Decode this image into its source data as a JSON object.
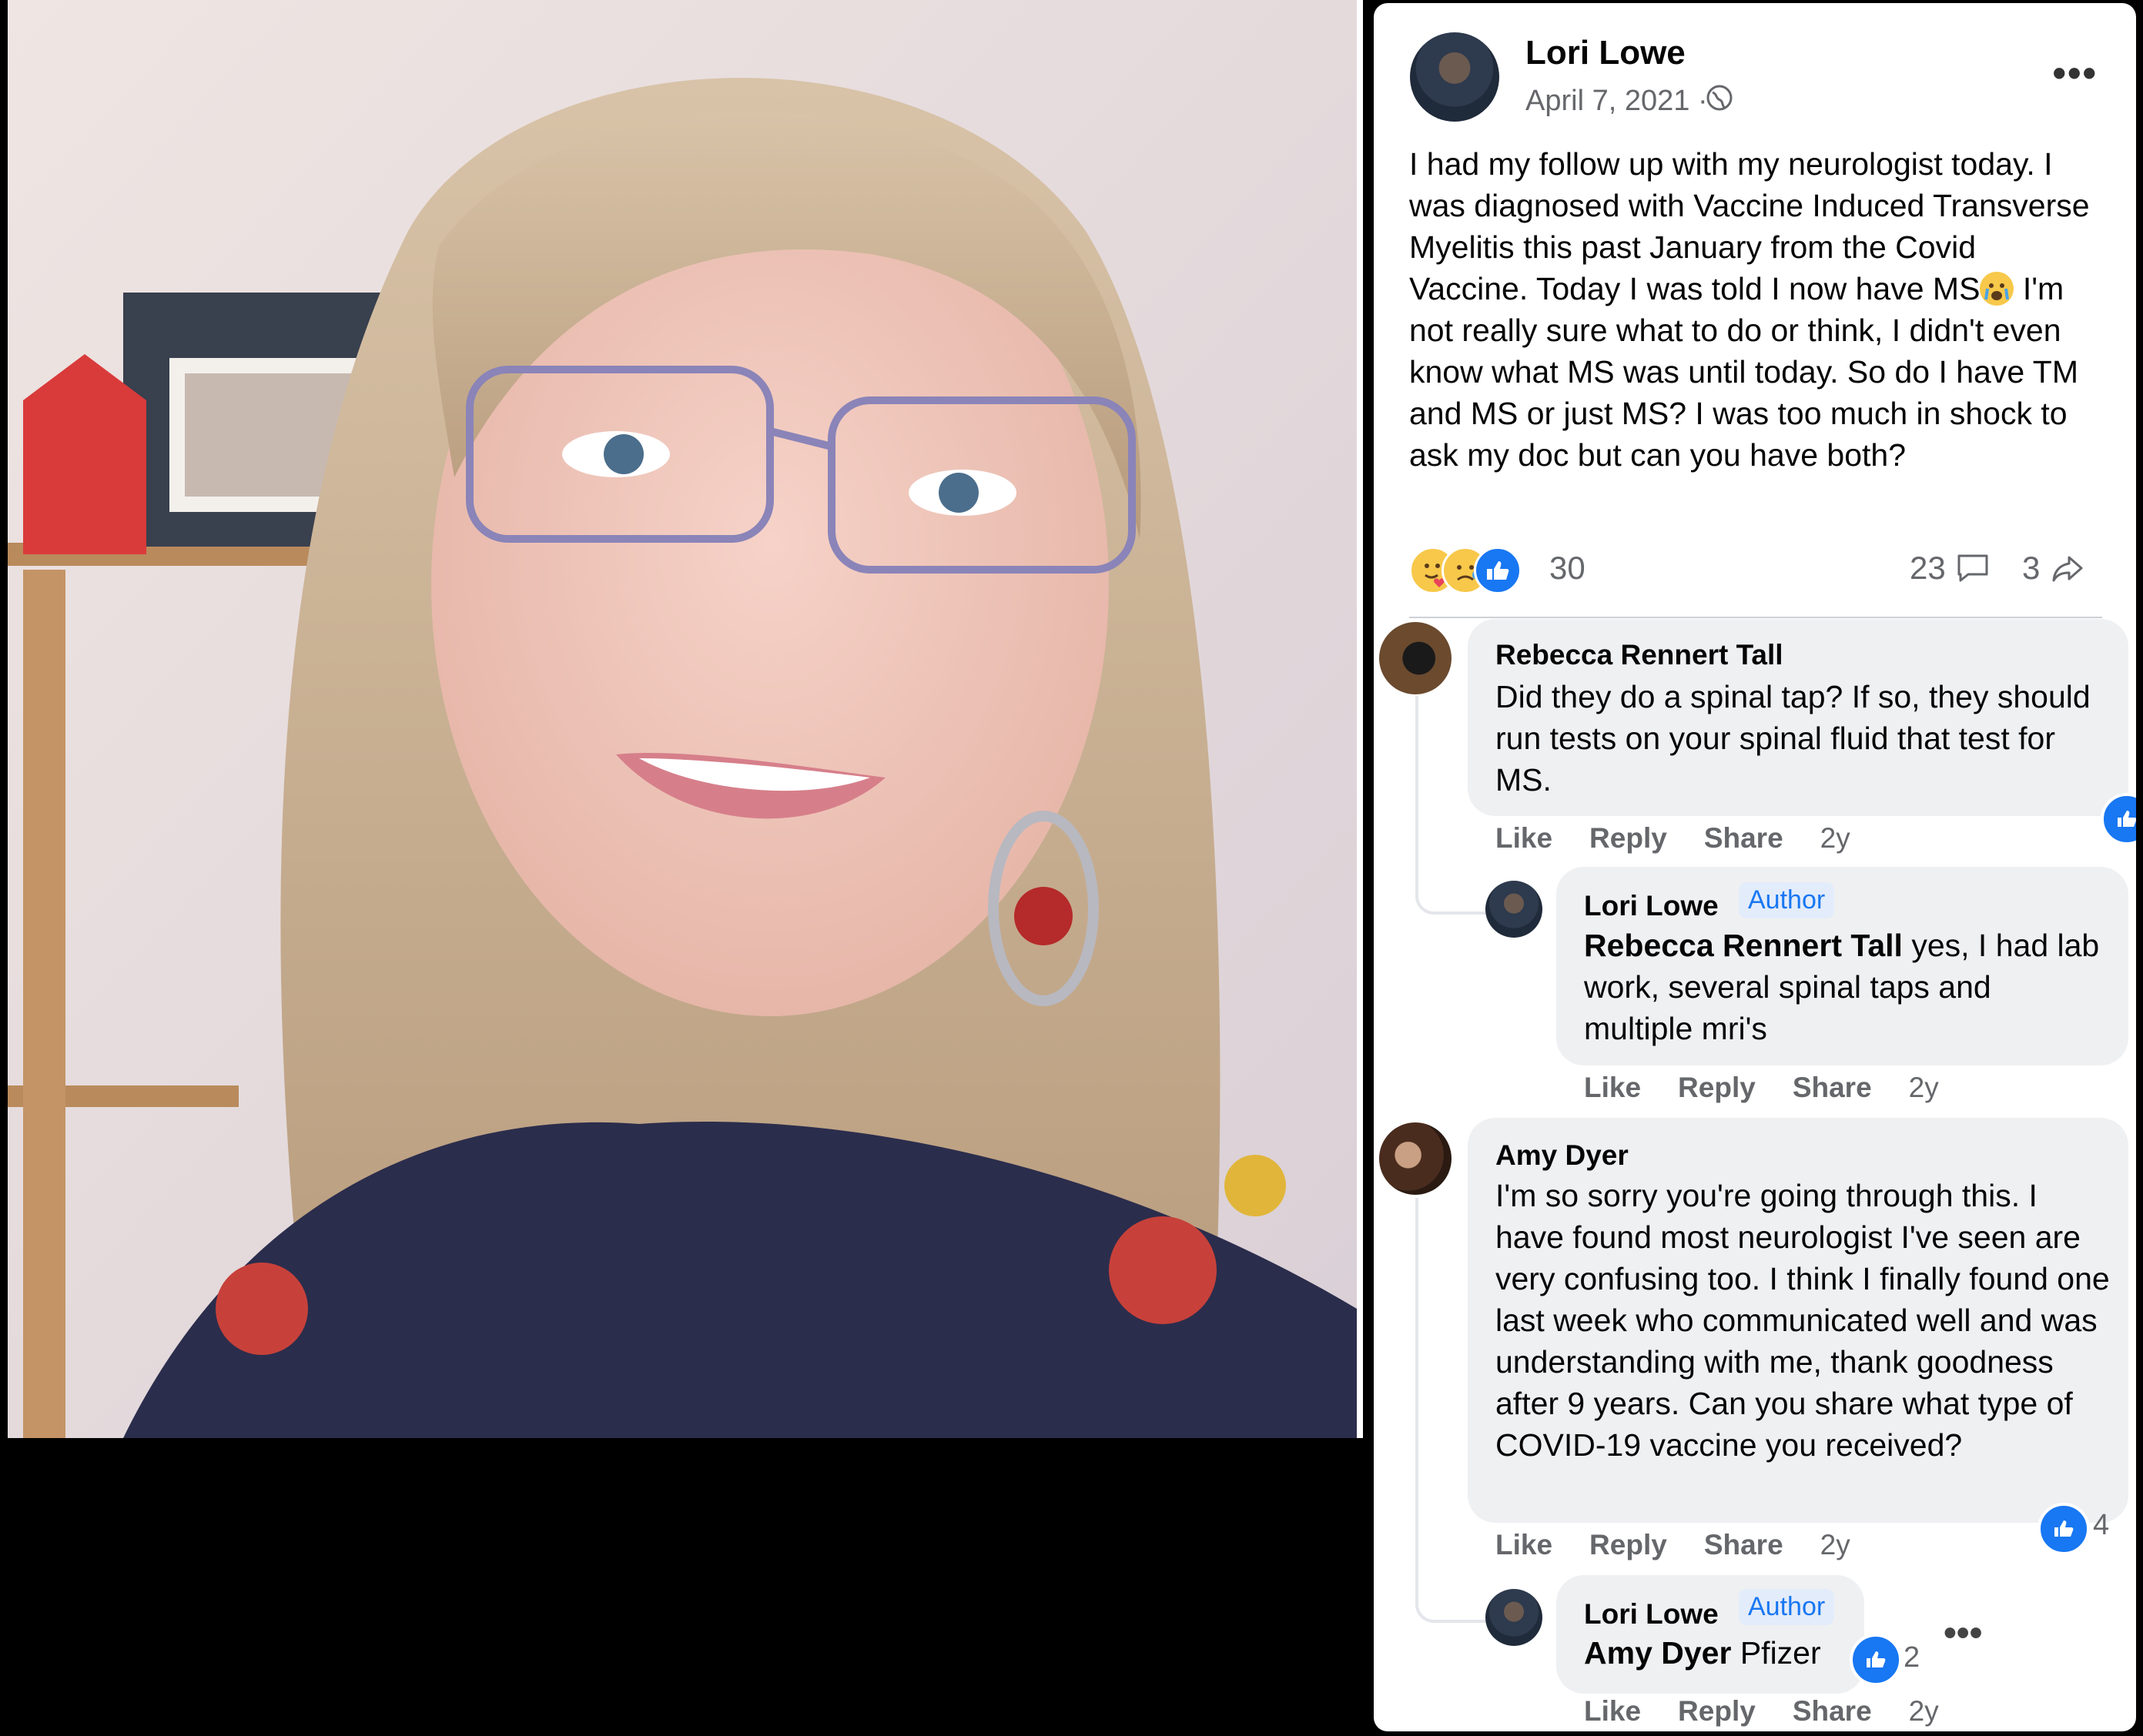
{
  "post": {
    "author": "Lori Lowe",
    "date": "April 7, 2021",
    "date_separator": "·",
    "text_parts": [
      "I had my follow up with my neurologist today. I was diagnosed with Vaccine Induced Transverse Myelitis this past January from the Covid Vaccine. Today I was told I now have MS",
      " I'm not really sure what to do or think, I didn't even know what MS was until today. So do I have TM and MS or just MS? I was too much in shock to ask my doc but can you have both?"
    ],
    "reactions_count": "30",
    "comments_count": "23",
    "shares_count": "3",
    "more_label": "•••"
  },
  "comments": [
    {
      "author": "Rebecca Rennert Tall",
      "text": "Did they do a spinal tap? If so, they should run tests on your spinal fluid that test for MS.",
      "like": "Like",
      "reply": "Reply",
      "share": "Share",
      "age": "2y"
    },
    {
      "author": "Lori Lowe",
      "badge": "Author",
      "mention": "Rebecca Rennert Tall",
      "text": " yes, I had lab work, several spinal taps and multiple mri's",
      "like": "Like",
      "reply": "Reply",
      "share": "Share",
      "age": "2y"
    },
    {
      "author": "Amy Dyer",
      "text": "I'm so sorry you're going through this. I have found most neurologist I've seen are very confusing too. I think I finally found one last week who communicated well and was understanding with me, thank goodness after 9 years. Can you share what type of COVID-19 vaccine you received?",
      "like_count": "4",
      "like": "Like",
      "reply": "Reply",
      "share": "Share",
      "age": "2y"
    },
    {
      "author": "Lori Lowe",
      "badge": "Author",
      "mention": "Amy Dyer",
      "text": " Pfizer",
      "like_count": "2",
      "more_label": "•••",
      "like": "Like",
      "reply": "Reply",
      "share": "Share",
      "age": "2y"
    }
  ],
  "colors": {
    "facebook_blue": "#1877f2",
    "bubble_gray": "#eff0f2",
    "secondary_text": "#65676b"
  }
}
